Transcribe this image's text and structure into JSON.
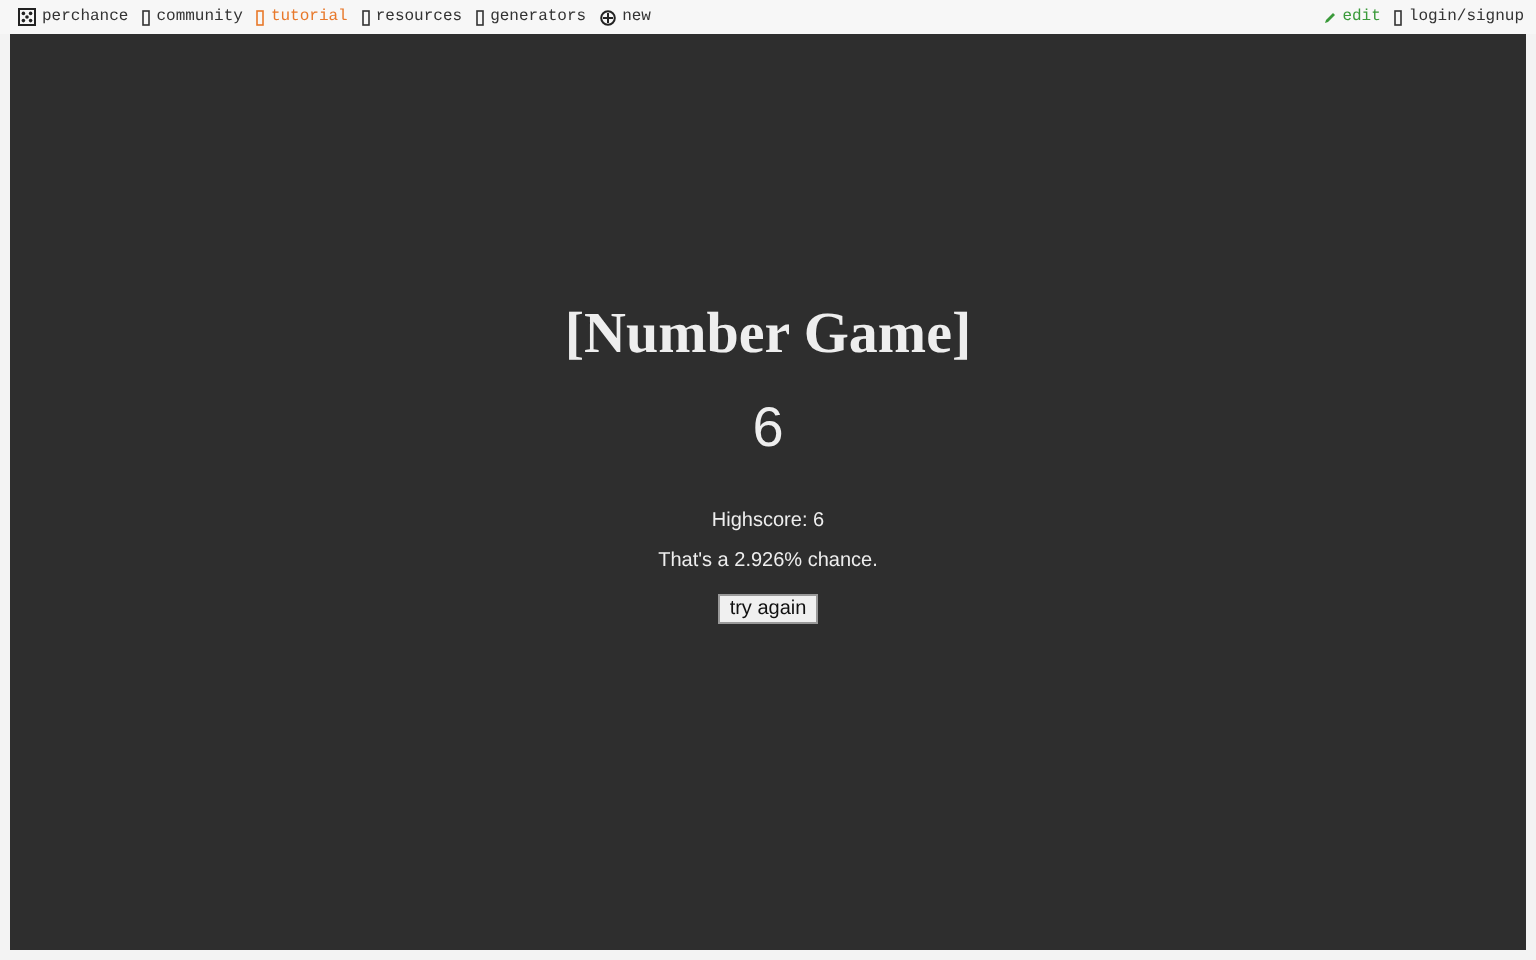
{
  "nav_left": [
    {
      "kind": "dice",
      "label": "perchance",
      "color": "#333333"
    },
    {
      "kind": "box",
      "label": "community",
      "color": "#333333"
    },
    {
      "kind": "box",
      "label": "tutorial",
      "color": "#e8782a"
    },
    {
      "kind": "box",
      "label": "resources",
      "color": "#333333"
    },
    {
      "kind": "box",
      "label": "generators",
      "color": "#333333"
    },
    {
      "kind": "plus",
      "label": "new",
      "color": "#333333"
    }
  ],
  "nav_right": [
    {
      "kind": "pencil",
      "label": "edit",
      "color": "#3a9a3a"
    },
    {
      "kind": "box",
      "label": "login/signup",
      "color": "#333333"
    }
  ],
  "game": {
    "title": "[Number Game]",
    "number": "6",
    "highscore": "Highscore: 6",
    "chance": "That's a 2.926% chance.",
    "button": "try again"
  }
}
